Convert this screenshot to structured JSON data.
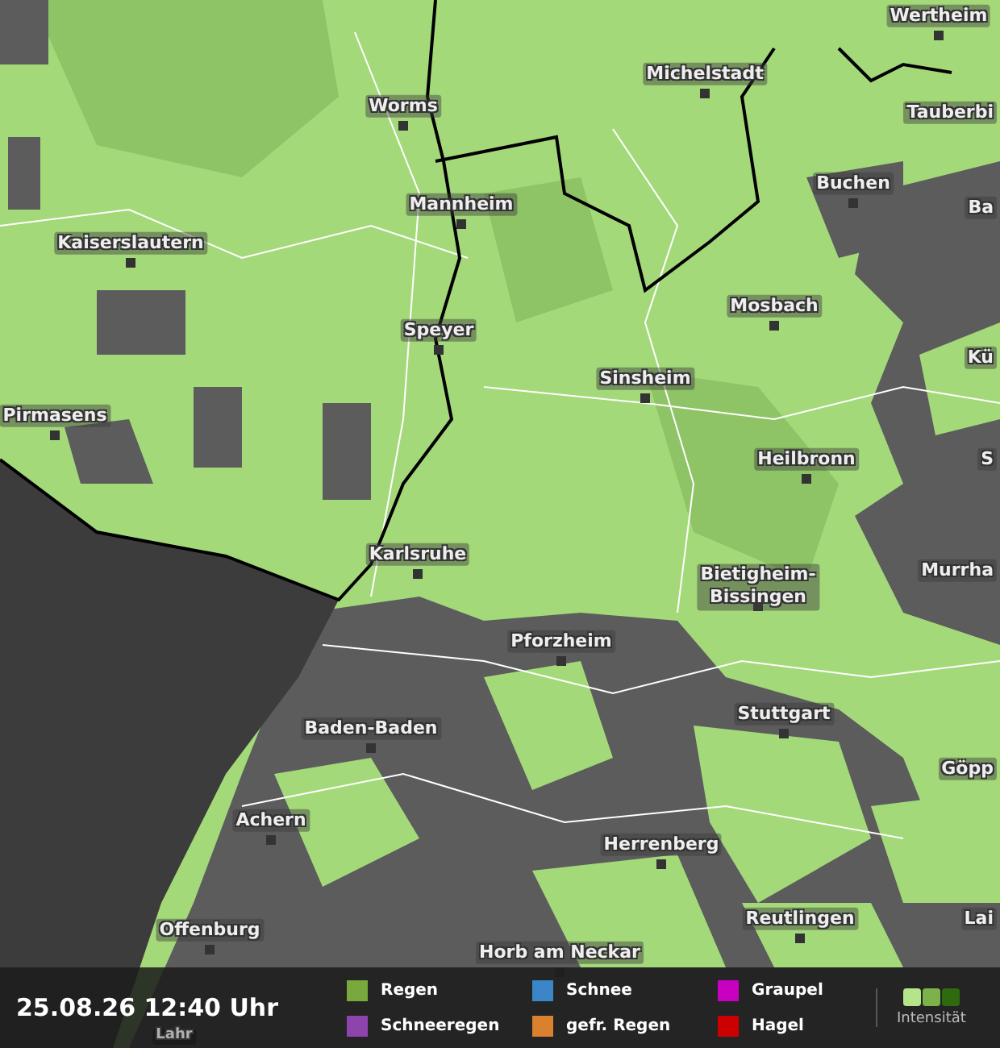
{
  "map": {
    "cities": [
      {
        "name": "Wertheim"
      },
      {
        "name": "Michelstadt"
      },
      {
        "name": "Worms"
      },
      {
        "name": "Tauberbi"
      },
      {
        "name": "Buchen"
      },
      {
        "name": "Ba"
      },
      {
        "name": "Mannheim"
      },
      {
        "name": "Kaiserslautern"
      },
      {
        "name": "Mosbach"
      },
      {
        "name": "Speyer"
      },
      {
        "name": "Kü"
      },
      {
        "name": "Sinsheim"
      },
      {
        "name": "Pirmasens"
      },
      {
        "name": "Heilbronn"
      },
      {
        "name": "S"
      },
      {
        "name": "Karlsruhe"
      },
      {
        "name": "Bietigheim-\nBissingen"
      },
      {
        "name": "Murrha"
      },
      {
        "name": "Pforzheim"
      },
      {
        "name": "Stuttgart"
      },
      {
        "name": "Baden-Baden"
      },
      {
        "name": "Göpp"
      },
      {
        "name": "Achern"
      },
      {
        "name": "Herrenberg"
      },
      {
        "name": "Reutlingen"
      },
      {
        "name": "Lai"
      },
      {
        "name": "Offenburg"
      },
      {
        "name": "Horb am Neckar"
      },
      {
        "name": "Lahr"
      }
    ]
  },
  "footer": {
    "timestamp": "25.08.26 12:40 Uhr",
    "legend": [
      {
        "label": "Regen",
        "color": "#79a83c"
      },
      {
        "label": "Schneeregen",
        "color": "#8e44ad"
      },
      {
        "label": "Schnee",
        "color": "#3a86c8"
      },
      {
        "label": "gefr. Regen",
        "color": "#d9812f"
      },
      {
        "label": "Graupel",
        "color": "#c800c0"
      },
      {
        "label": "Hagel",
        "color": "#cc0000"
      }
    ],
    "intensity": {
      "label": "Intensität",
      "swatches": [
        {
          "color": "#b4e58a"
        },
        {
          "color": "#7db24a"
        },
        {
          "color": "#2f6a10"
        }
      ]
    }
  }
}
